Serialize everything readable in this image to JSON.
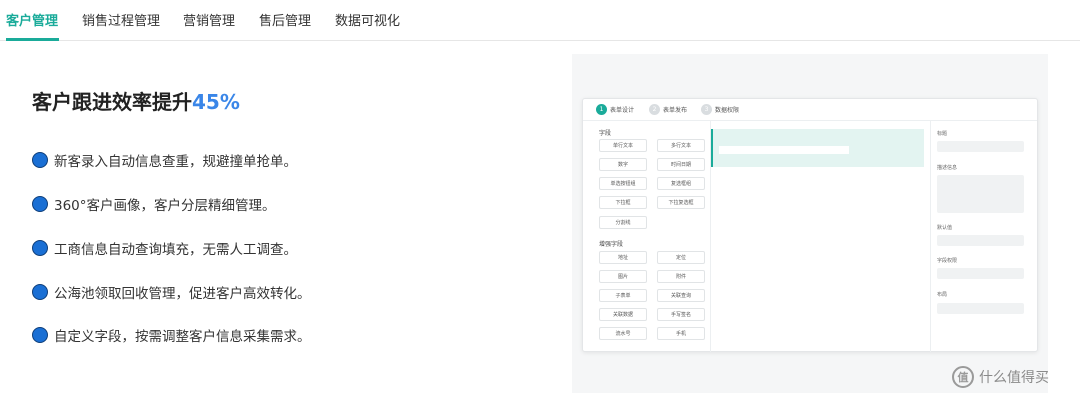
{
  "tabs": [
    {
      "label": "客户管理",
      "active": true
    },
    {
      "label": "销售过程管理",
      "active": false
    },
    {
      "label": "营销管理",
      "active": false
    },
    {
      "label": "售后管理",
      "active": false
    },
    {
      "label": "数据可视化",
      "active": false
    }
  ],
  "headline": {
    "text": "客户跟进效率提升",
    "highlight": "45%"
  },
  "features": [
    "新客录入自动信息查重，规避撞单抢单。",
    "360°客户画像，客户分层精细管理。",
    "工商信息自动查询填充，无需人工调查。",
    "公海池领取回收管理，促进客户高效转化。",
    "自定义字段，按需调整客户信息采集需求。"
  ],
  "mock": {
    "steps": [
      {
        "num": "1",
        "label": "表单设计",
        "active": true
      },
      {
        "num": "2",
        "label": "表单发布",
        "active": false
      },
      {
        "num": "3",
        "label": "数据权限",
        "active": false
      }
    ],
    "field_group_label": "字段",
    "fields": [
      "单行文本",
      "多行文本",
      "数字",
      "时间日期",
      "单选按钮组",
      "复选框组",
      "下拉框",
      "下拉复选框",
      "分割线"
    ],
    "enhanced_group_label": "增强字段",
    "enhanced_fields": [
      "地址",
      "定位",
      "图片",
      "附件",
      "子表单",
      "关联查询",
      "关联数据",
      "手写签名",
      "流水号",
      "手机"
    ],
    "props": [
      "标题",
      "描述信息",
      "默认值",
      "字段权限",
      "布局"
    ]
  },
  "watermark": {
    "text": "什么值得买",
    "logo_glyph": "值"
  },
  "colors": {
    "accent": "#1aab9a",
    "highlight": "#3a86e8",
    "bullet": "#1a6fd4"
  }
}
